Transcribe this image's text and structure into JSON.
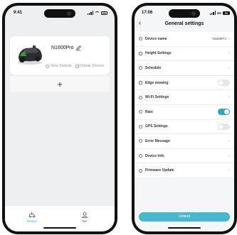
{
  "phone_a": {
    "status": {
      "time": "9:41"
    },
    "device": {
      "name": "N1600Pro",
      "view_details": "View Details",
      "delete_device": "Delete Device"
    },
    "add_symbol": "+",
    "tabs": [
      {
        "label": "Device",
        "icon": "mower-icon",
        "active": true
      },
      {
        "label": "Me",
        "icon": "person-icon",
        "active": false
      }
    ]
  },
  "phone_b": {
    "status": {
      "time": "17:06",
      "battery": "51"
    },
    "title": "General settings",
    "rows": [
      {
        "label": "Device name",
        "value": "N1600Pro",
        "control": "chevron",
        "icon": "device-icon"
      },
      {
        "label": "Height Settings",
        "control": "chevron",
        "icon": "height-icon"
      },
      {
        "label": "Schedule",
        "control": "chevron",
        "icon": "schedule-icon"
      },
      {
        "label": "Edge mowing",
        "control": "toggle",
        "on": false,
        "icon": "edge-icon"
      },
      {
        "label": "Wi-Fi Settings",
        "control": "chevron",
        "icon": "wifi-icon"
      },
      {
        "label": "Rain",
        "control": "toggle",
        "on": true,
        "icon": "rain-icon"
      },
      {
        "label": "GPS Settings",
        "control": "toggle",
        "on": false,
        "icon": "gps-icon"
      },
      {
        "label": "Error Message",
        "control": "chevron",
        "icon": "error-icon"
      },
      {
        "label": "Device Info",
        "control": "chevron",
        "icon": "info-icon"
      },
      {
        "label": "Firmware Update",
        "control": "chevron",
        "icon": "firmware-icon"
      }
    ],
    "unbind_label": "Unbind"
  },
  "colors": {
    "accent": "#2fa7c4",
    "unbind": "#44b8cf",
    "mower_green": "#2e9c3a"
  }
}
